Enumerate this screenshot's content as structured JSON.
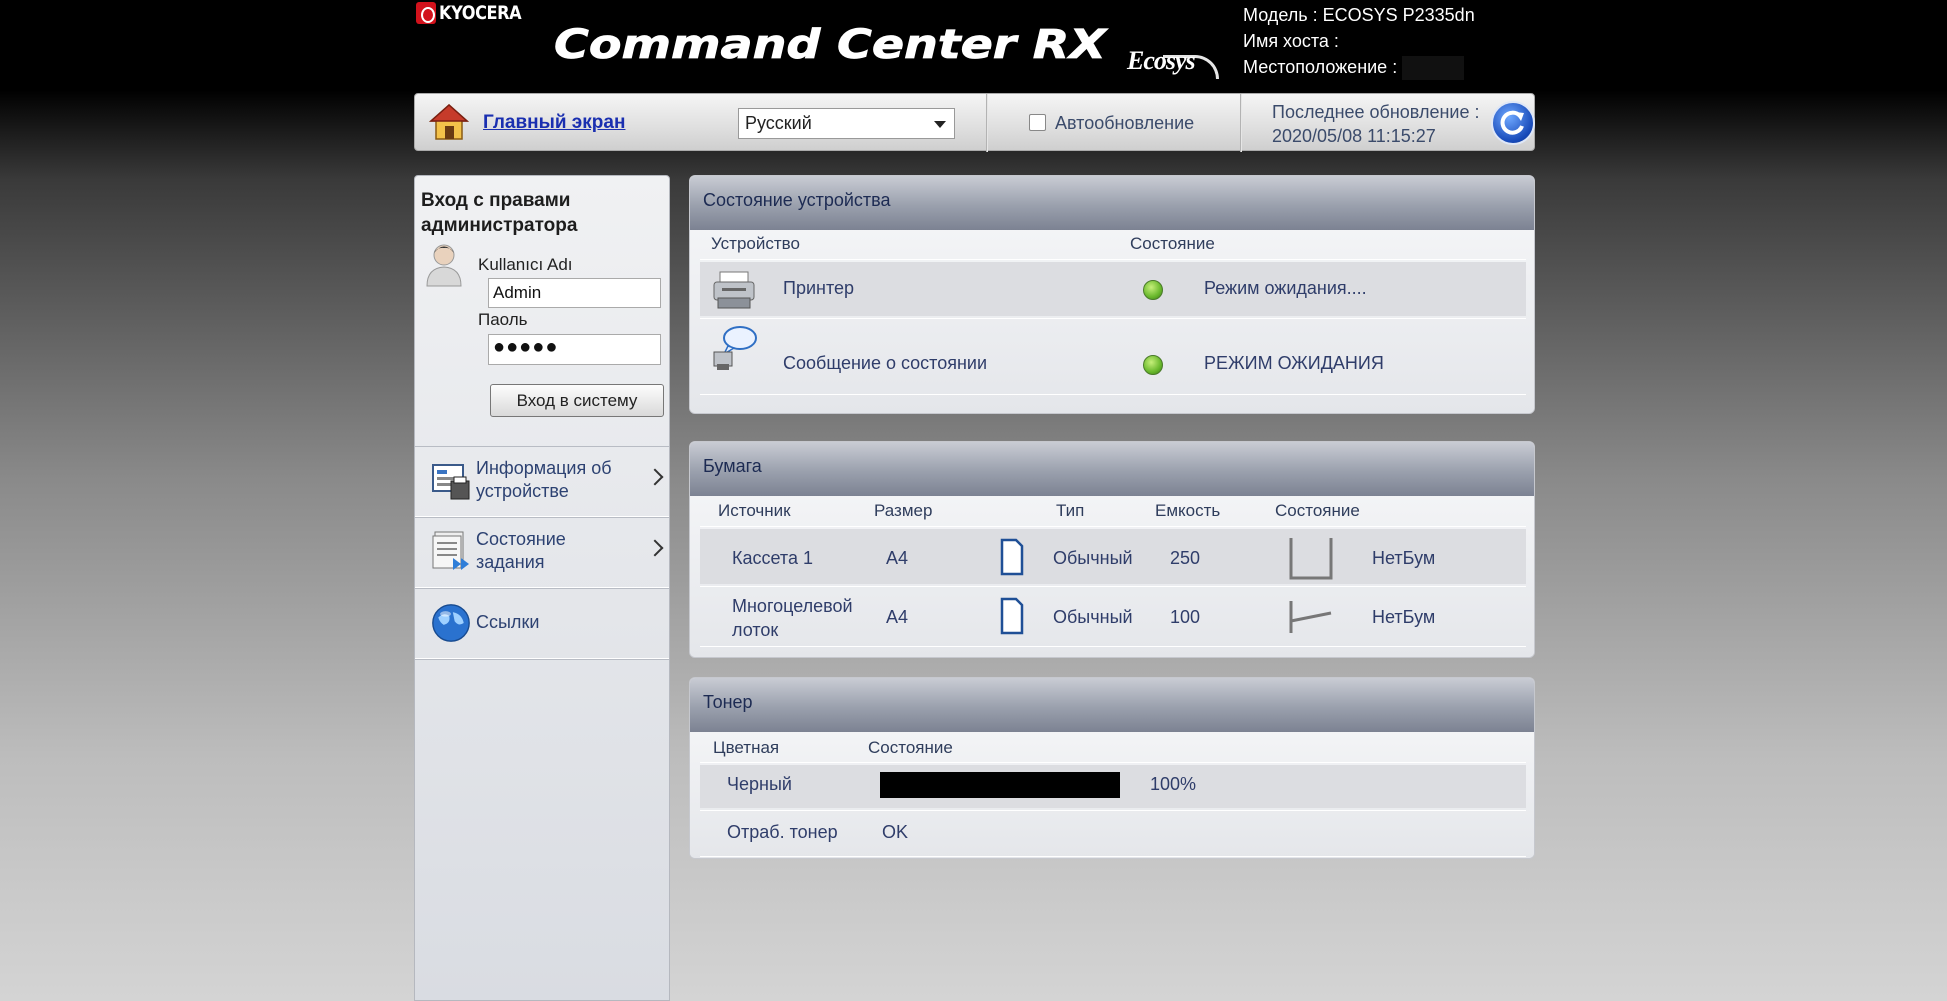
{
  "header": {
    "brand": "KYOCERA",
    "app_title": "Command Center RX",
    "ecosys_logo": "Ecosys",
    "model_label": "Модель : ECOSYS P2335dn",
    "host_label": "Имя хоста :",
    "location_label": "Местоположение :"
  },
  "topbar": {
    "home_icon": "home-icon",
    "home_link": "Главный экран",
    "language": "Русский",
    "auto_refresh_label": "Автообновление",
    "auto_refresh_checked": false,
    "last_update_label": "Последнее обновление :",
    "last_update_value": "2020/05/08 11:15:27",
    "refresh_icon": "refresh-icon"
  },
  "sidebar": {
    "login_title_line1": "Вход с правами",
    "login_title_line2": "администратора",
    "username_label": "Kullanıcı Adı",
    "username_value": "Admin",
    "password_label": "Паоль",
    "password_value": "●●●●●",
    "login_button": "Вход в систему",
    "nav": [
      {
        "label_line1": "Информация об",
        "label_line2": "устройстве",
        "icon": "device-info-icon",
        "has_chevron": true
      },
      {
        "label_line1": "Состояние",
        "label_line2": "задания",
        "icon": "job-status-icon",
        "has_chevron": true
      },
      {
        "label_line1": "Ссылки",
        "label_line2": "",
        "icon": "globe-links-icon",
        "has_chevron": false
      }
    ]
  },
  "device_status": {
    "title": "Состояние устройства",
    "col_device": "Устройство",
    "col_status": "Состояние",
    "rows": [
      {
        "device": "Принтер",
        "status": "Режим ожидания....",
        "icon": "printer-icon",
        "led": "green"
      },
      {
        "device": "Сообщение о состоянии",
        "status": "РЕЖИМ ОЖИДАНИЯ",
        "icon": "status-message-icon",
        "led": "green"
      }
    ]
  },
  "paper": {
    "title": "Бумага",
    "col_source": "Источник",
    "col_size": "Размер",
    "col_type": "Тип",
    "col_capacity": "Емкость",
    "col_status": "Состояние",
    "rows": [
      {
        "source_line1": "Кассета 1",
        "source_line2": "",
        "size": "A4",
        "type": "Обычный",
        "capacity": "250",
        "status": "НетБум",
        "tray_icon": "cassette-tray-icon"
      },
      {
        "source_line1": "Многоцелевой",
        "source_line2": "лоток",
        "size": "A4",
        "type": "Обычный",
        "capacity": "100",
        "status": "НетБум",
        "tray_icon": "mp-tray-icon"
      }
    ]
  },
  "toner": {
    "title": "Тонер",
    "col_color": "Цветная",
    "col_status": "Состояние",
    "black_label": "Черный",
    "black_level": "100%",
    "waste_label": "Отраб. тонер",
    "waste_status": "OK"
  },
  "colors": {
    "link": "#1a2fb0",
    "text": "#2f3d6a",
    "led_green": "#69b82c",
    "brand_red": "#d2121c"
  }
}
